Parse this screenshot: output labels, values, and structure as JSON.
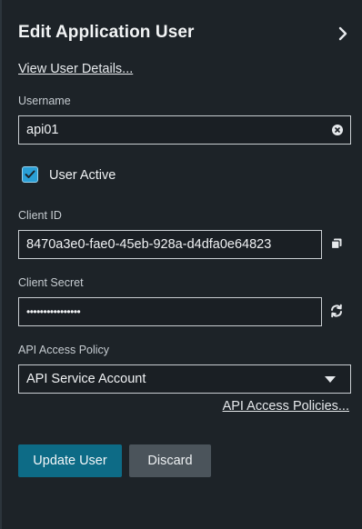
{
  "header": {
    "title": "Edit Application User"
  },
  "links": {
    "view_details": "View User Details...",
    "policies": "API Access Policies..."
  },
  "username": {
    "label": "Username",
    "value": "api01"
  },
  "active": {
    "label": "User Active",
    "checked": true
  },
  "client_id": {
    "label": "Client ID",
    "value": "8470a3e0-fae0-45eb-928a-d4dfa0e64823"
  },
  "client_secret": {
    "label": "Client Secret",
    "value": "••••••••••••••••"
  },
  "policy": {
    "label": "API Access Policy",
    "selected": "API Service Account"
  },
  "buttons": {
    "update": "Update User",
    "discard": "Discard"
  },
  "colors": {
    "accent": "#0d6b86",
    "checkbox": "#2a9fd6",
    "background": "#1d2328"
  },
  "icons": {
    "collapse": "chevron-right-icon",
    "clear": "clear-icon",
    "copy": "copy-icon",
    "regenerate": "refresh-icon",
    "dropdown": "caret-down-icon"
  }
}
